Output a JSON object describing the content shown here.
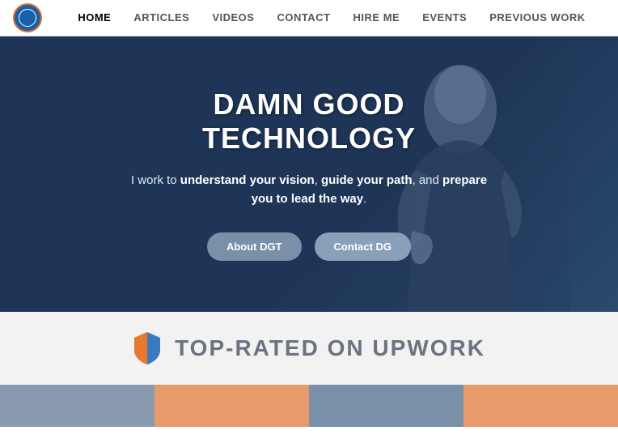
{
  "nav": {
    "links": [
      {
        "label": "HOME",
        "active": true
      },
      {
        "label": "ARTICLES",
        "active": false
      },
      {
        "label": "VIDEOS",
        "active": false
      },
      {
        "label": "CONTACT",
        "active": false
      },
      {
        "label": "HIRE ME",
        "active": false
      },
      {
        "label": "EVENTS",
        "active": false
      },
      {
        "label": "PREVIOUS WORK",
        "active": false
      }
    ]
  },
  "hero": {
    "title": "DAMN GOOD TECHNOLOGY",
    "subtitle_plain1": "I work to ",
    "subtitle_bold1": "understand your vision",
    "subtitle_plain2": ", ",
    "subtitle_bold2": "guide your path",
    "subtitle_plain3": ", and ",
    "subtitle_bold3": "prepare you to lead the way",
    "subtitle_plain4": ".",
    "btn_about": "About DGT",
    "btn_contact": "Contact DG"
  },
  "upwork": {
    "title": "TOP-RATED ON UPWORK"
  },
  "color_bars": [
    {
      "color": "#8a9bb0"
    },
    {
      "color": "#e89b6a"
    },
    {
      "color": "#7a8fa8"
    },
    {
      "color": "#e89b6a"
    }
  ]
}
